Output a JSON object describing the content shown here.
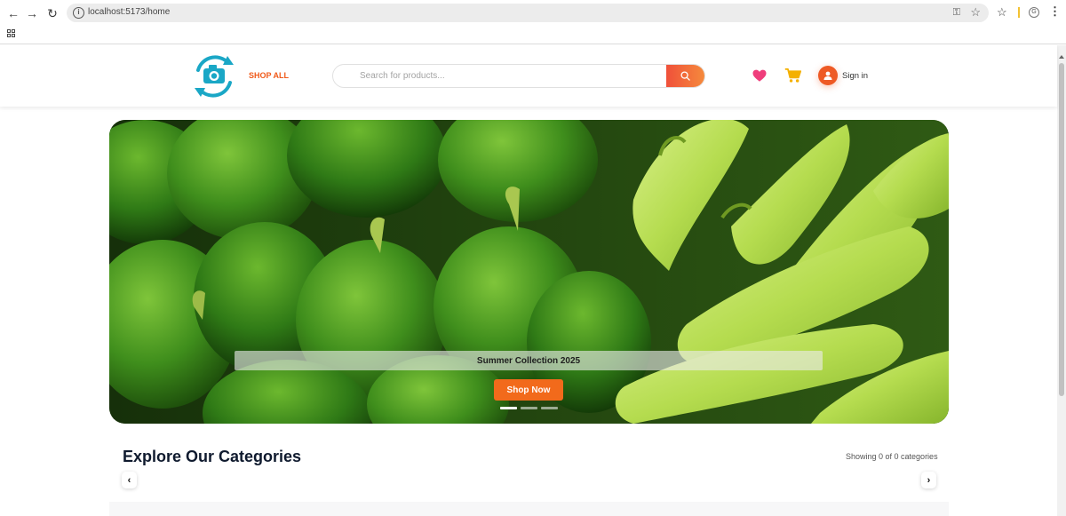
{
  "browser": {
    "url": "localhost:5173/home",
    "profile_initial": "G"
  },
  "header": {
    "shop_all": "SHOP ALL",
    "search_placeholder": "Search for products...",
    "signin_label": "Sign in"
  },
  "hero": {
    "caption": "Summer Collection 2025",
    "cta_label": "Shop Now",
    "slide_count": 3,
    "active_slide": 1
  },
  "categories": {
    "title": "Explore Our Categories",
    "count_text": "Showing 0 of 0 categories"
  },
  "colors": {
    "accent": "#f05a1a",
    "logo": "#1aa7c6",
    "heart": "#ef3e7c",
    "cart": "#f4b000"
  }
}
